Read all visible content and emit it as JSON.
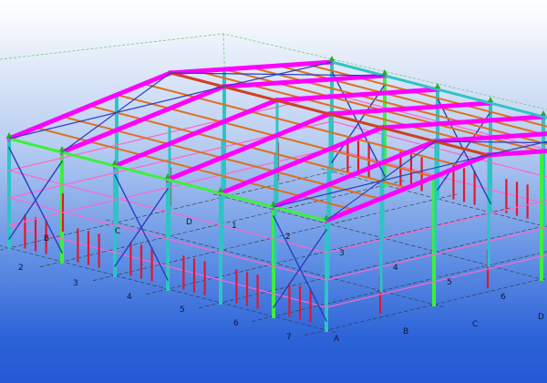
{
  "viewport": {
    "colors": {
      "background_top": "#ffffff",
      "background_bottom": "#2459d4"
    }
  },
  "model": {
    "colors": {
      "rafter": "#ff00ff",
      "purlin": "#e07020",
      "column": "#2ec4c4",
      "column_alt": "#3cf03c",
      "bracing": "#2b3fc0",
      "girt": "#ff66cc",
      "secondary": "#e01830",
      "ridge": "#d04020",
      "support": "#2aa82a",
      "gridline": "#333333"
    }
  },
  "grid_labels": {
    "near_1": "1",
    "near_2": "2",
    "near_3": "3",
    "near_4": "4",
    "near_5": "5",
    "near_6": "6",
    "near_7": "7",
    "near_B": "B",
    "near_C": "C",
    "near_D": "D",
    "far_2": "2",
    "far_3": "3",
    "far_4": "4",
    "far_5": "5",
    "far_6": "6",
    "far_A": "A",
    "far_B": "B",
    "far_C": "C",
    "far_D": "D"
  }
}
